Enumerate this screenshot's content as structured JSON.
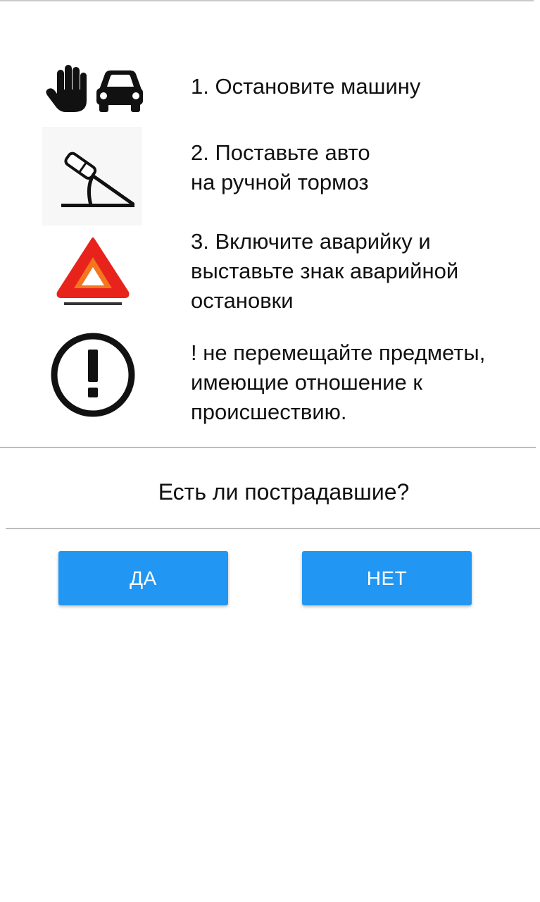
{
  "steps": [
    {
      "icon": "hand-and-car-icon",
      "text": "1. Остановите машину"
    },
    {
      "icon": "handbrake-icon",
      "text": "2. Поставьте авто\nна ручной тормоз"
    },
    {
      "icon": "warning-triangle-icon",
      "text": "3. Включите аварийку и\nвыставьте знак аварийной\nостановки"
    },
    {
      "icon": "exclamation-circle-icon",
      "text": "!  не перемещайте предметы,\nимеющие отношение к\nпроисшествию."
    }
  ],
  "question": "Есть ли пострадавшие?",
  "buttons": {
    "yes_label": "ДА",
    "no_label": "НЕТ"
  },
  "colors": {
    "button": "#2196f3",
    "triangle_outer": "#e8231c",
    "triangle_inner": "#f4761f"
  }
}
